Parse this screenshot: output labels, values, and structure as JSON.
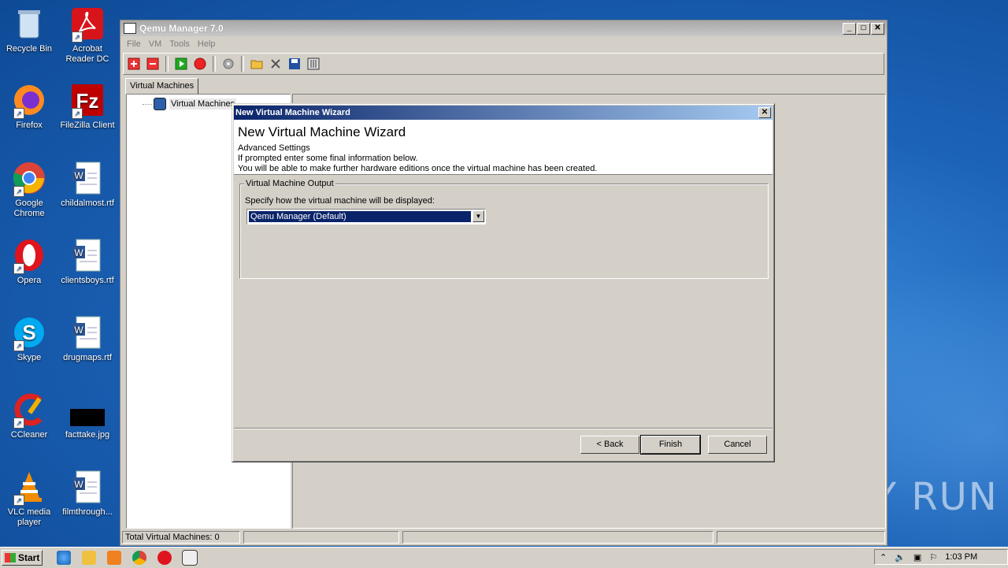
{
  "desktop": {
    "icons": [
      {
        "label": "Recycle Bin",
        "icon": "recycle-bin-icon"
      },
      {
        "label": "Acrobat Reader DC",
        "icon": "acrobat-icon"
      },
      {
        "label": "Firefox",
        "icon": "firefox-icon"
      },
      {
        "label": "FileZilla Client",
        "icon": "filezilla-icon"
      },
      {
        "label": "Google Chrome",
        "icon": "chrome-icon"
      },
      {
        "label": "childalmost.rtf",
        "icon": "word-doc-icon"
      },
      {
        "label": "Opera",
        "icon": "opera-icon"
      },
      {
        "label": "clientsboys.rtf",
        "icon": "word-doc-icon"
      },
      {
        "label": "Skype",
        "icon": "skype-icon"
      },
      {
        "label": "drugmaps.rtf",
        "icon": "word-doc-icon"
      },
      {
        "label": "CCleaner",
        "icon": "ccleaner-icon"
      },
      {
        "label": "facttake.jpg",
        "icon": "image-file-icon"
      },
      {
        "label": "VLC media player",
        "icon": "vlc-icon"
      },
      {
        "label": "filmthrough...",
        "icon": "word-doc-icon"
      }
    ],
    "watermark": "ANY RUN"
  },
  "app": {
    "title": "Qemu Manager 7.0",
    "menu": [
      "File",
      "VM",
      "Tools",
      "Help"
    ],
    "tab": "Virtual Machines",
    "tree_root": "Virtual Machines",
    "status": "Total Virtual Machines: 0"
  },
  "dialog": {
    "window_title": "New Virtual Machine Wizard",
    "heading": "New Virtual Machine Wizard",
    "subtitle": "Advanced Settings",
    "line1": "If prompted enter some final information below.",
    "line2": "You will be able to make further hardware editions once the virtual machine has been created.",
    "group_label": "Virtual Machine Output",
    "prompt": "Specify how the virtual machine will be displayed:",
    "display_value": "Qemu Manager (Default)",
    "buttons": {
      "back": "< Back",
      "finish": "Finish",
      "cancel": "Cancel"
    }
  },
  "taskbar": {
    "start": "Start",
    "clock": "1:03 PM"
  },
  "colors": {
    "dialog_title_start": "#0a246a",
    "selection": "#0a246a",
    "desktop": "#1c63b8"
  }
}
